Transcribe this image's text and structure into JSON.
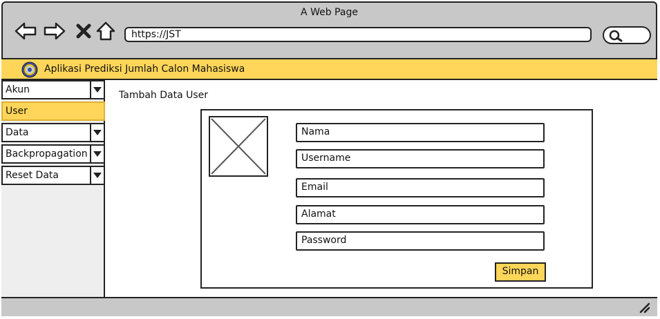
{
  "window": {
    "title": "A Web Page"
  },
  "browser": {
    "url": "https://JST"
  },
  "app": {
    "title": "Aplikasi Prediksi Jumlah Calon Mahasiswa"
  },
  "sidebar": {
    "items": [
      {
        "label": "Akun",
        "dropdown": true
      },
      {
        "label": "User",
        "dropdown": false,
        "active": true
      },
      {
        "label": "Data",
        "dropdown": true
      },
      {
        "label": "Backpropagation",
        "dropdown": true
      },
      {
        "label": "Reset Data",
        "dropdown": true
      }
    ]
  },
  "main": {
    "title": "Tambah Data User",
    "form": {
      "fields": [
        {
          "placeholder": "Nama"
        },
        {
          "placeholder": "Username"
        },
        {
          "placeholder": "Email"
        },
        {
          "placeholder": "Alamat"
        },
        {
          "placeholder": "Password"
        }
      ],
      "submit_label": "Simpan"
    }
  },
  "colors": {
    "accent": "#ffd659",
    "chrome": "#c8c8c8",
    "sidebar": "#eeeeee"
  }
}
